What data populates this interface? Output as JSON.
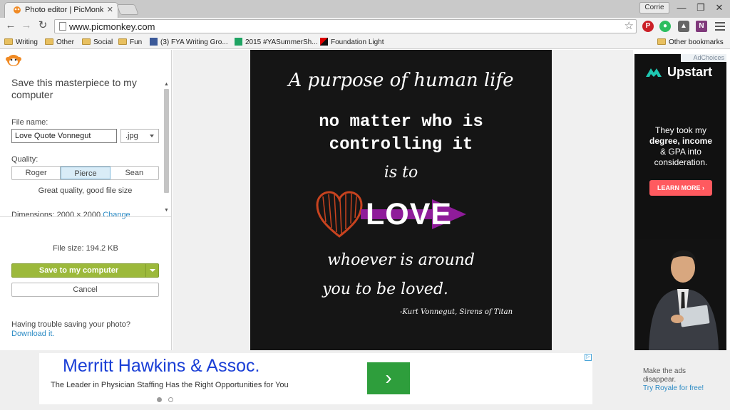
{
  "browser": {
    "tab_title": "Photo editor | PicMonkey",
    "profile_name": "Corrie",
    "url": "www.picmonkey.com",
    "window_controls": [
      "minimize-icon",
      "restore-icon",
      "close-icon"
    ],
    "extensions": [
      "pinterest-icon",
      "evernote-icon",
      "stamp-icon",
      "onenote-icon",
      "notepad-icon"
    ]
  },
  "bookmarks": {
    "items": [
      {
        "label": "Writing",
        "icon": "folder-icon"
      },
      {
        "label": "Other",
        "icon": "folder-icon"
      },
      {
        "label": "Social",
        "icon": "folder-icon"
      },
      {
        "label": "Fun",
        "icon": "folder-icon"
      },
      {
        "label": "(3) FYA Writing Gro...",
        "icon": "facebook-icon"
      },
      {
        "label": "2015 #YASummerSh...",
        "icon": "sheets-icon"
      },
      {
        "label": "Foundation Light",
        "icon": "foundation-icon"
      }
    ],
    "other_bookmarks": "Other bookmarks"
  },
  "save_panel": {
    "title": "Save this masterpiece to my computer",
    "file_name_label": "File name:",
    "file_name_value": "Love Quote Vonnegut",
    "format_value": ".jpg",
    "quality_label": "Quality:",
    "quality_options": [
      "Roger",
      "Pierce",
      "Sean"
    ],
    "quality_selected": "Pierce",
    "quality_description": "Great quality, good file size",
    "dimensions_label": "Dimensions:",
    "dimensions_value": "2000 × 2000",
    "change_link": "Change",
    "file_size": "File size: 194.2 KB",
    "save_button": "Save to my computer",
    "cancel_button": "Cancel",
    "trouble_text": "Having trouble saving your photo?",
    "download_link": "Download it."
  },
  "artwork": {
    "line1": "A purpose of human life",
    "line2": "no matter who is",
    "line3": "controlling it",
    "line4": "is to",
    "love": "LOVE",
    "line5": "whoever is around",
    "line6": "you to be loved.",
    "credit": "-Kurt Vonnegut, Sirens of Titan",
    "colors": {
      "background": "#151515",
      "heart": "#c8431f",
      "arrow": "#8f1c9a"
    }
  },
  "right_ad": {
    "adchoices": "AdChoices",
    "brand": "Upstart",
    "headline_line1": "They took my",
    "headline_line2": "degree, income",
    "headline_line3": "& GPA into",
    "headline_line4": "consideration.",
    "cta": "LEARN MORE ›",
    "colors": {
      "cta": "#ff5a5f",
      "brand_mark": "#1fc7b1"
    }
  },
  "bottom_ad": {
    "title": "Merritt Hawkins & Assoc.",
    "description": "The Leader in Physician Staffing Has the Right Opportunities for You",
    "arrow": "›",
    "make_ads_line1": "Make the ads",
    "make_ads_line2": "disappear.",
    "royale_link": "Try Royale for free!"
  }
}
